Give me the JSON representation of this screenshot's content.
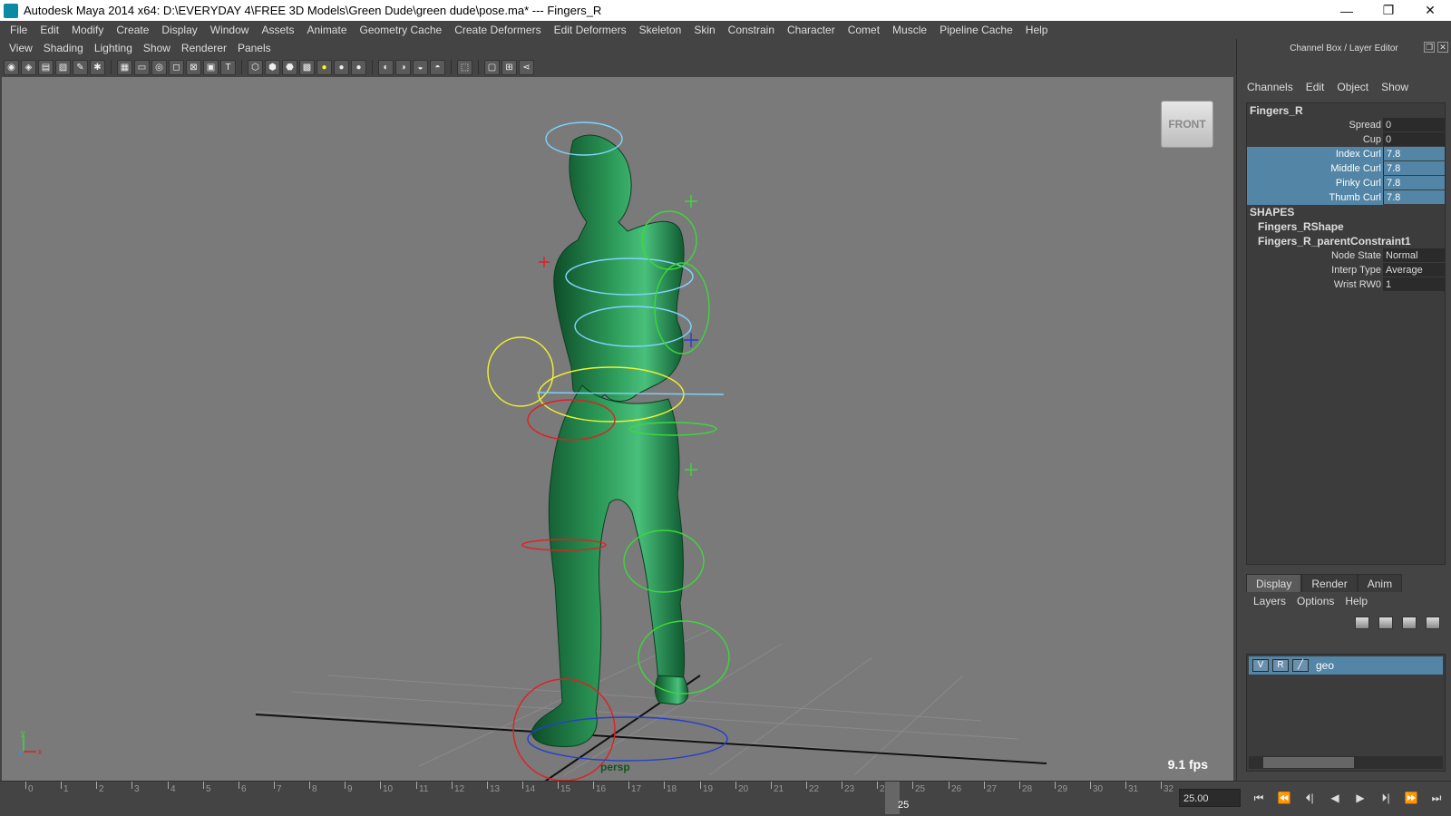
{
  "window": {
    "title": "Autodesk Maya 2014 x64: D:\\EVERYDAY 4\\FREE 3D Models\\Green Dude\\green dude\\pose.ma*   ---   Fingers_R",
    "controls": [
      "—",
      "❐",
      "✕"
    ]
  },
  "menubar": [
    "File",
    "Edit",
    "Modify",
    "Create",
    "Display",
    "Window",
    "Assets",
    "Animate",
    "Geometry Cache",
    "Create Deformers",
    "Edit Deformers",
    "Skeleton",
    "Skin",
    "Constrain",
    "Character",
    "Comet",
    "Muscle",
    "Pipeline Cache",
    "Help"
  ],
  "panel_menu": [
    "View",
    "Shading",
    "Lighting",
    "Show",
    "Renderer",
    "Panels"
  ],
  "viewport": {
    "fps": "9.1 fps",
    "camera": "persp",
    "viewcube": "FRONT",
    "axis_x": "x",
    "axis_y": "y",
    "axis_z": "z",
    "background": "#7a7a7a",
    "mesh_color": "#1f7a44"
  },
  "channel_box": {
    "header": "Channel Box / Layer Editor",
    "menu": [
      "Channels",
      "Edit",
      "Object",
      "Show"
    ],
    "node": "Fingers_R",
    "attributes": [
      {
        "name": "Spread",
        "value": "0",
        "selected": false
      },
      {
        "name": "Cup",
        "value": "0",
        "selected": false
      },
      {
        "name": "Index Curl",
        "value": "7.8",
        "selected": true
      },
      {
        "name": "Middle Curl",
        "value": "7.8",
        "selected": true
      },
      {
        "name": "Pinky Curl",
        "value": "7.8",
        "selected": true
      },
      {
        "name": "Thumb Curl",
        "value": "7.8",
        "selected": true
      }
    ],
    "shapes_label": "SHAPES",
    "shape_node": "Fingers_RShape",
    "constraint_node": "Fingers_R_parentConstraint1",
    "constraint_attrs": [
      {
        "name": "Node State",
        "value": "Normal"
      },
      {
        "name": "Interp Type",
        "value": "Average"
      },
      {
        "name": "Wrist RW0",
        "value": "1"
      }
    ],
    "selected_color": "#5285a6"
  },
  "layer_editor": {
    "tabs": [
      "Display",
      "Render",
      "Anim"
    ],
    "active_tab": "Display",
    "menu": [
      "Layers",
      "Options",
      "Help"
    ],
    "layer": {
      "v": "V",
      "r": "R",
      "name": "geo"
    }
  },
  "timeline": {
    "ticks": [
      "0",
      "1",
      "2",
      "3",
      "4",
      "5",
      "6",
      "7",
      "8",
      "9",
      "10",
      "11",
      "12",
      "13",
      "14",
      "15",
      "16",
      "17",
      "18",
      "19",
      "20",
      "21",
      "22",
      "23",
      "24",
      "25",
      "26",
      "27",
      "28",
      "29",
      "30",
      "31",
      "32"
    ],
    "current_frame": "25",
    "frame_field": "25.00",
    "playback_buttons": [
      "⏮",
      "⏪",
      "⏴|",
      "◀",
      "▶",
      "⏵|",
      "⏩",
      "⏭"
    ]
  }
}
